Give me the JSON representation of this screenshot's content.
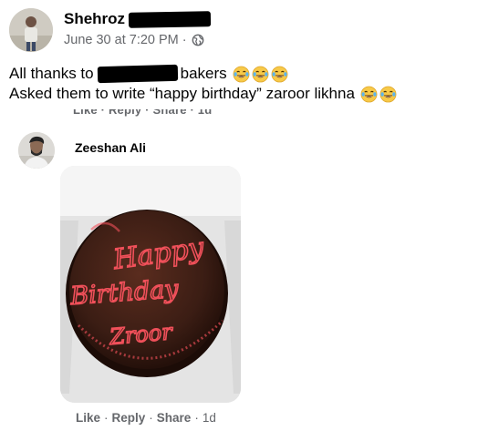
{
  "post": {
    "author": "Shehroz",
    "date": "June 30 at 7:20 PM",
    "separator": "·",
    "privacy_icon": "globe-icon",
    "line1_prefix": "All thanks to",
    "line1_suffix": "bakers",
    "line2": "Asked them to write “happy birthday” zaroor likhna",
    "emoji_icon": "face-with-tears-of-joy-icon"
  },
  "previous_comment_actions": "Like · Reply · Share · 1d",
  "comment": {
    "author": "Zeeshan Ali",
    "cake_text": [
      "Happy",
      "Birthday",
      "Zroor"
    ],
    "actions": {
      "like": "Like",
      "reply": "Reply",
      "share": "Share",
      "time": "1d",
      "separator": "·"
    }
  },
  "colors": {
    "meta_gray": "#65676b",
    "icing_red": "#f0505a",
    "cake_brown": "#3b1d14"
  }
}
